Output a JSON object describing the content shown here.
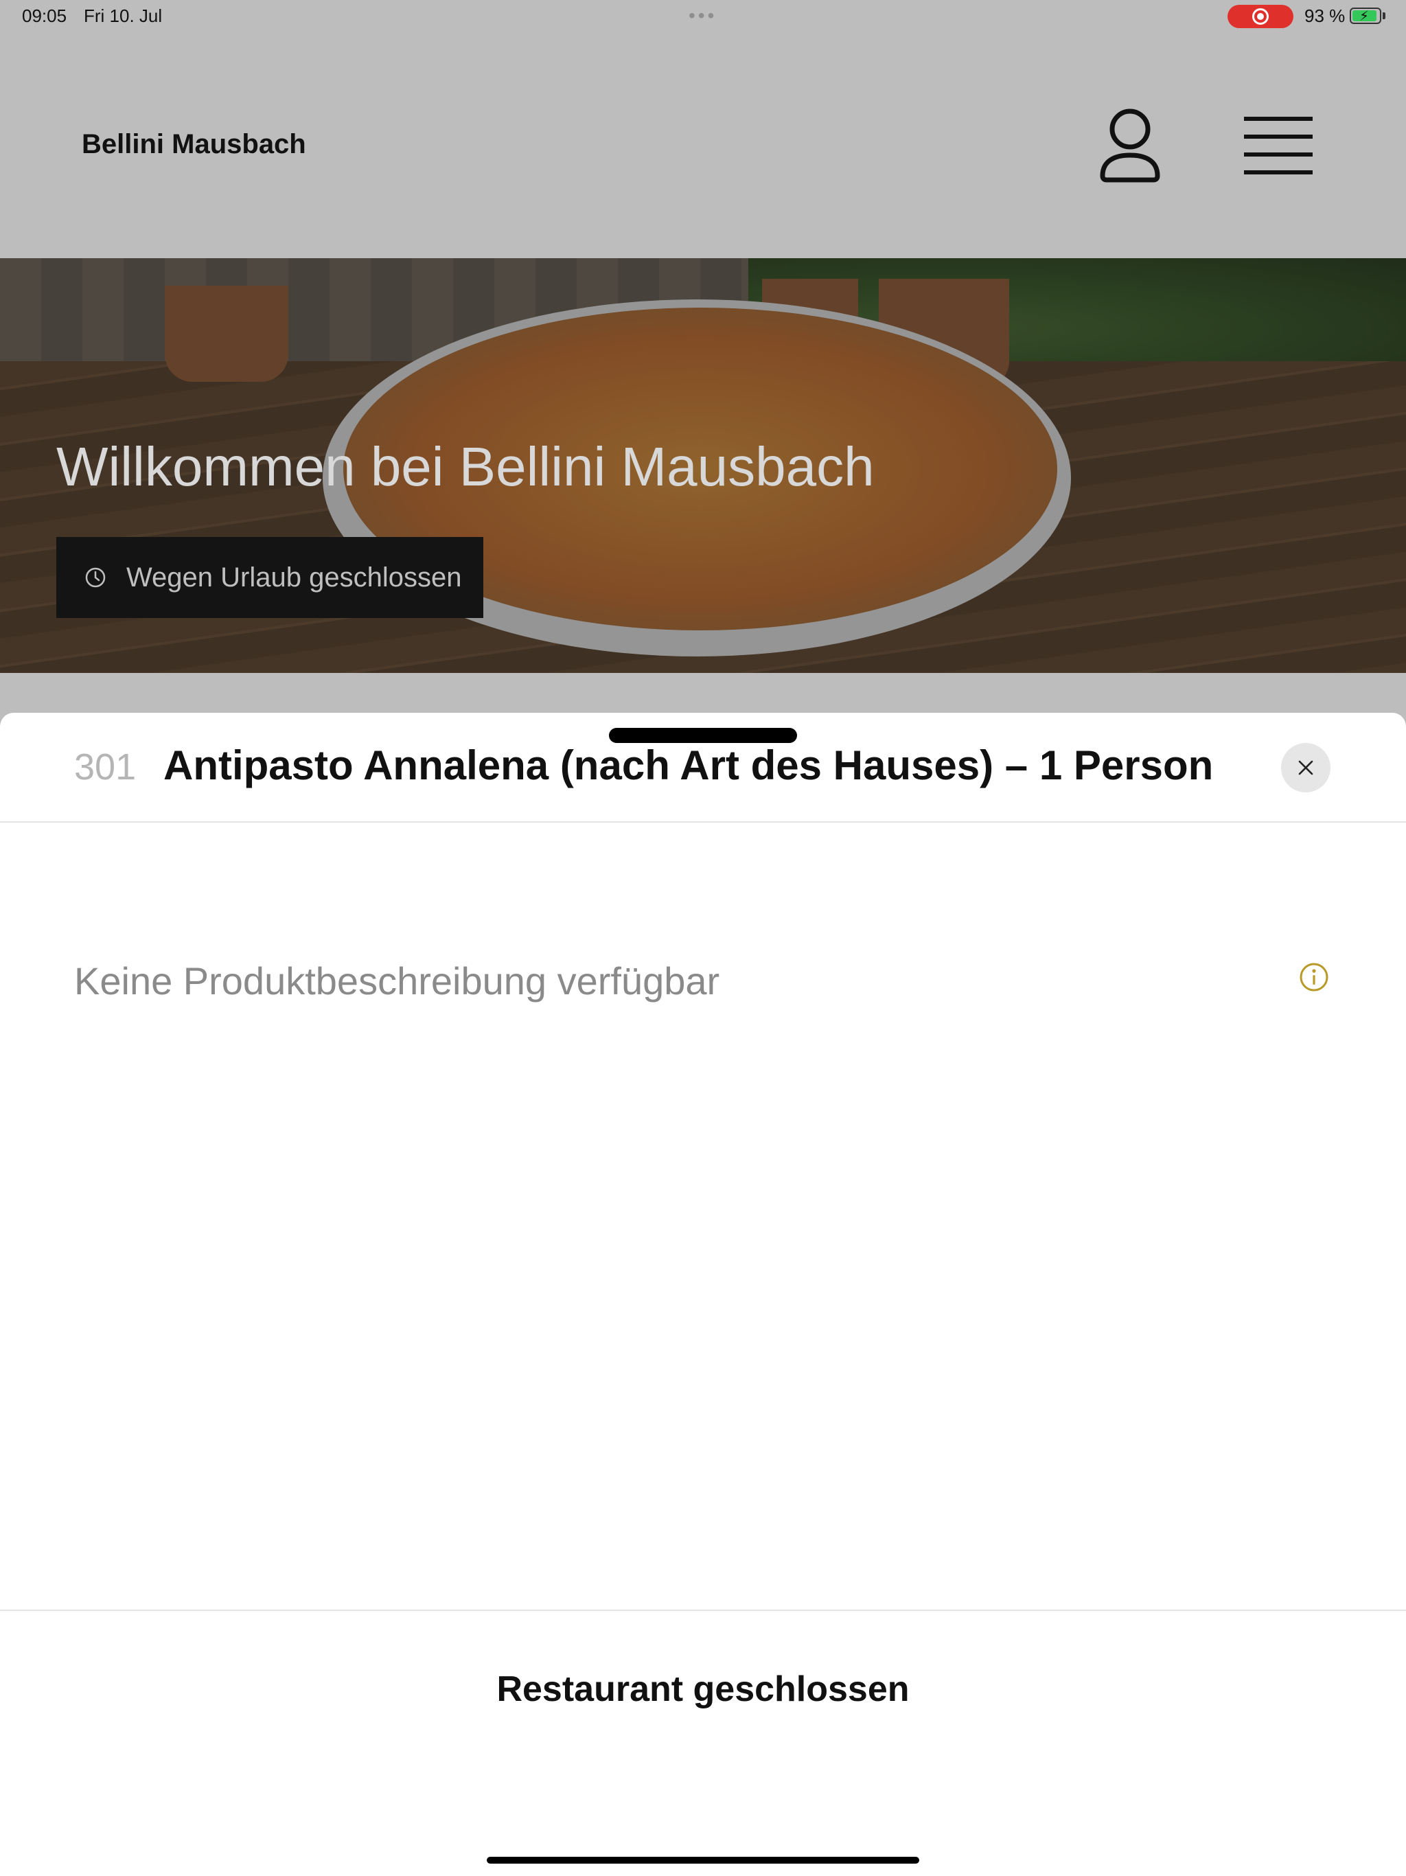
{
  "status_bar": {
    "time": "09:05",
    "date": "Fri 10. Jul",
    "battery": "93 %",
    "battery_level": 0.93,
    "recording": true,
    "colors": {
      "record": "#e0302b",
      "battery": "#34c759"
    }
  },
  "header": {
    "brand": "Bellini Mausbach",
    "icons": [
      "user-icon",
      "menu-icon"
    ]
  },
  "hero": {
    "title": "Willkommen bei Bellini Mausbach",
    "status": "Wegen Urlaub geschlossen",
    "status_icon": "clock-icon"
  },
  "sheet": {
    "item_number": "301",
    "item_title": "Antipasto Annalena (nach Art des Hauses) – 1 Person",
    "description": "Keine Produktbeschreibung verfügbar",
    "info_icon_color": "#b89a2a",
    "footer_label": "Restaurant geschlossen"
  }
}
